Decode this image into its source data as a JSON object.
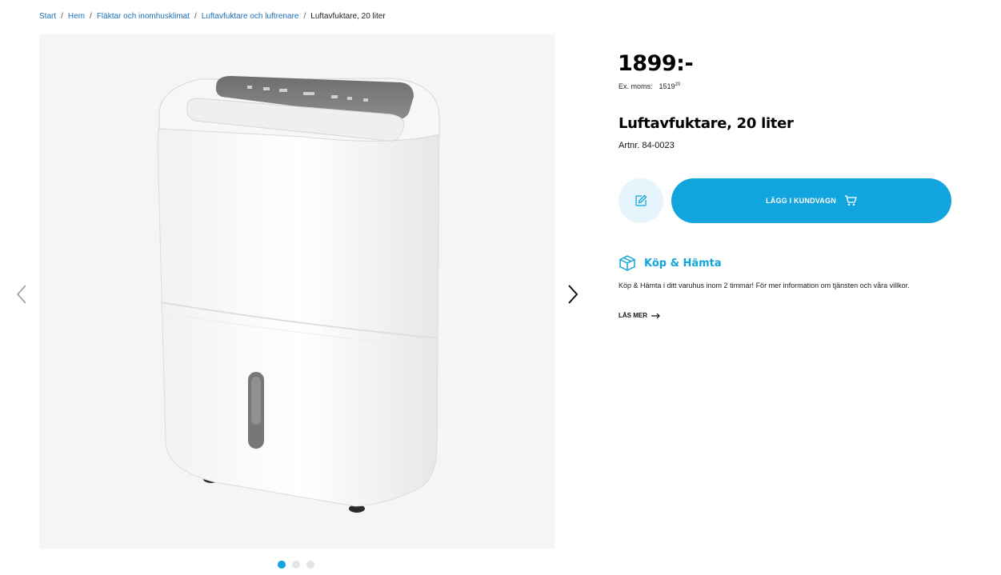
{
  "breadcrumb": {
    "items": [
      "Start",
      "Hem",
      "Fläktar och inomhusklimat",
      "Luftavfuktare och luftrenare"
    ],
    "current": "Luftavfuktare, 20 liter",
    "separator": "/"
  },
  "gallery": {
    "image_name": "dehumidifier-product-image",
    "slides": 3,
    "active_slide": 1
  },
  "product": {
    "price": "1899:-",
    "ex_vat_label": "Ex. moms:",
    "ex_vat_price_main": "1519",
    "ex_vat_price_cents": "20",
    "title": "Luftavfuktare, 20 liter",
    "article_number": "Artnr. 84-0023"
  },
  "actions": {
    "add_to_cart_label": "LÄGG I KUNDVAGN"
  },
  "pickup": {
    "title": "Köp & Hämta",
    "description": "Köp & Hämta i ditt varuhus inom 2 timmar! För mer information om tjänsten och våra villkor.",
    "read_more": "LÄS MER"
  },
  "colors": {
    "accent": "#12a4dc",
    "link": "#1d6fb8",
    "wishlist_bg": "#e6f4fb"
  },
  "icons": [
    "chevron-left-icon",
    "chevron-right-icon",
    "edit-note-icon",
    "cart-icon",
    "box-icon",
    "arrow-right-icon"
  ]
}
